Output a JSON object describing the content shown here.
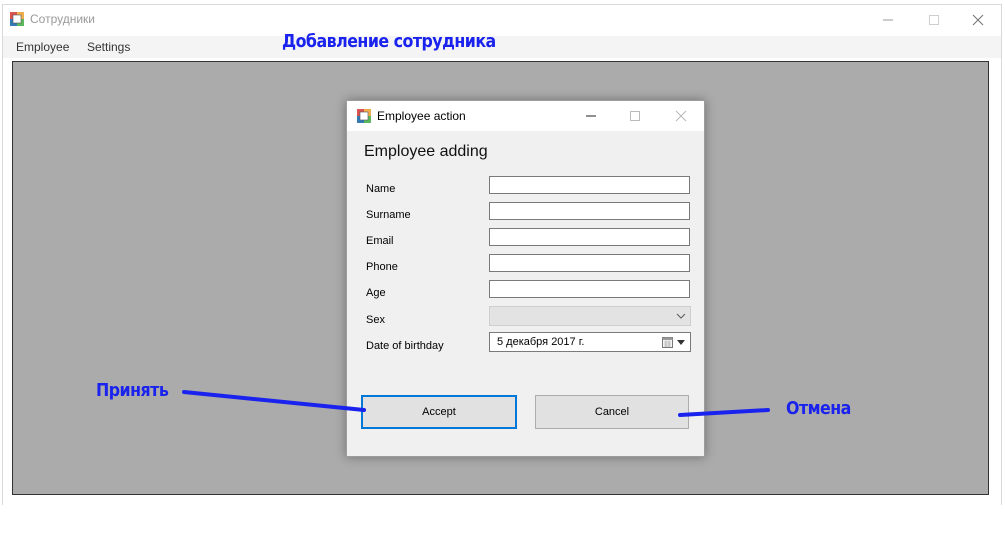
{
  "window": {
    "title": "Сотрудники",
    "menu": [
      "Employee",
      "Settings"
    ]
  },
  "annotations": {
    "header": "Добавление сотрудника",
    "accept": "Принять",
    "cancel": "Отмена",
    "color": "#1a22ee"
  },
  "dialog": {
    "title": "Employee action",
    "heading": "Employee adding",
    "fields": [
      {
        "label": "Name",
        "value": ""
      },
      {
        "label": "Surname",
        "value": ""
      },
      {
        "label": "Email",
        "value": ""
      },
      {
        "label": "Phone",
        "value": ""
      },
      {
        "label": "Age",
        "value": ""
      }
    ],
    "sex": {
      "label": "Sex",
      "value": ""
    },
    "birthday": {
      "label": "Date of birthday",
      "value": "5  декабря  2017 г."
    },
    "accept_label": "Accept",
    "cancel_label": "Cancel",
    "accent_color": "#0078d7"
  }
}
